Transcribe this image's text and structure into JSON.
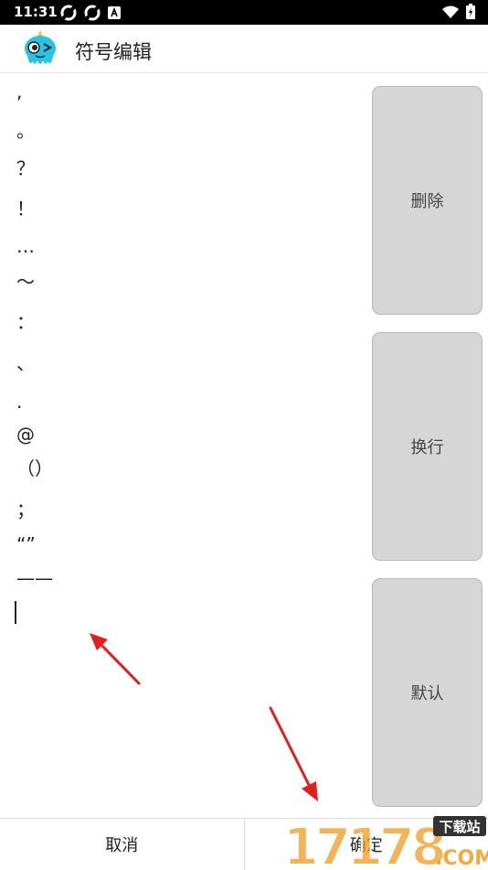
{
  "status_bar": {
    "time": "11:31"
  },
  "app": {
    "title": "符号编辑"
  },
  "editor": {
    "lines": [
      ",",
      "。",
      "？",
      "！",
      "…",
      "～",
      "：",
      "、",
      ".",
      "@",
      "（）",
      "；",
      "“”",
      "——"
    ]
  },
  "side_buttons": {
    "delete_label": "删除",
    "newline_label": "换行",
    "default_label": "默认"
  },
  "bottom": {
    "cancel_label": "取消",
    "confirm_label": "确定"
  },
  "watermark": {
    "number": "17178",
    "badge": "下载站",
    "suffix": ".COM"
  },
  "colors": {
    "annotation_arrow": "#e02020",
    "button_bg": "#d6d6d6",
    "watermark_orange": "#f29a1f"
  }
}
